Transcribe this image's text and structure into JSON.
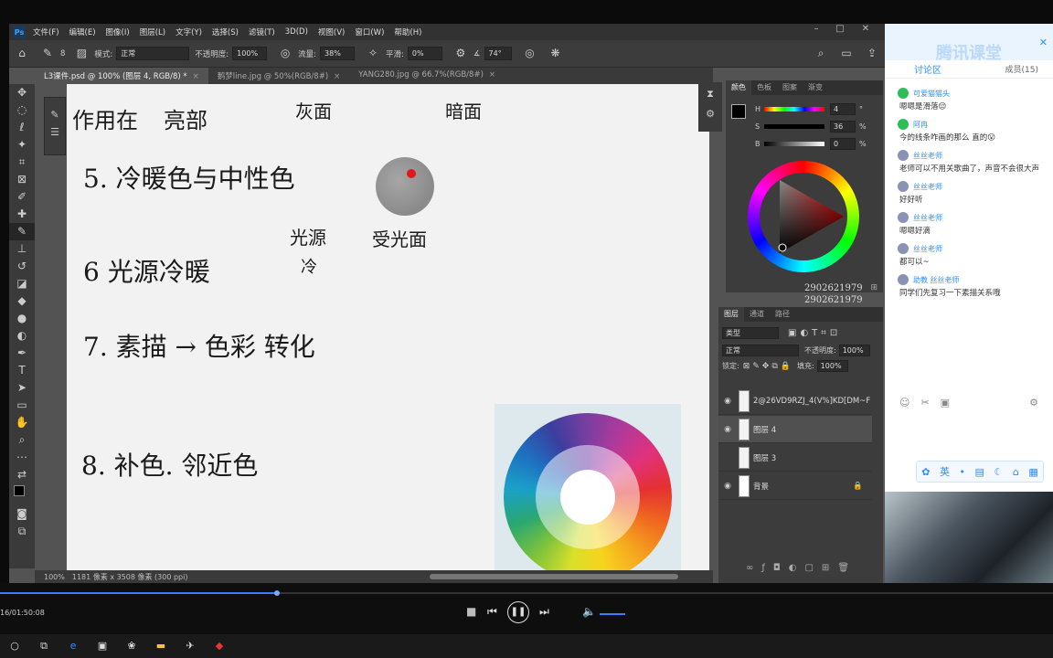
{
  "menu": [
    "文件(F)",
    "编辑(E)",
    "图像(I)",
    "图层(L)",
    "文字(Y)",
    "选择(S)",
    "滤镜(T)",
    "3D(D)",
    "视图(V)",
    "窗口(W)",
    "帮助(H)"
  ],
  "options": {
    "brush_size": "8",
    "mode_label": "模式:",
    "mode_value": "正常",
    "opacity_label": "不透明度:",
    "opacity_value": "100%",
    "flow_label": "流量:",
    "flow_value": "38%",
    "smooth_label": "平滑:",
    "smooth_value": "0%",
    "angle_value": "74°"
  },
  "tabs": [
    {
      "label": "L3课件.psd @ 100% (图层 4, RGB/8) *"
    },
    {
      "label": "鹅梦line.jpg @ 50%(RGB/8#)"
    },
    {
      "label": "YANG280.jpg @ 66.7%(RGB/8#)"
    }
  ],
  "canvas_text": {
    "l1a": "作用在",
    "l1b": "亮部",
    "l1c": "灰面",
    "l1d": "暗面",
    "l5": "5. 冷暖色与中性色",
    "l6": "6  光源冷暖",
    "l6b": "光源",
    "l6c": "冷",
    "l6d": "受光面",
    "l7": "7. 素描 → 色彩 转化",
    "l8": "8. 补色. 邻近色"
  },
  "status": {
    "zoom": "100%",
    "doc_info": "1181 像素 x 3508 像素 (300 ppi)"
  },
  "color_panel": {
    "tabs": [
      "颜色",
      "色板",
      "图案",
      "渐变"
    ],
    "h_label": "H",
    "h_value": "4",
    "h_unit": "°",
    "s_label": "S",
    "s_value": "36",
    "s_unit": "%",
    "b_label": "B",
    "b_value": "0",
    "b_unit": "%",
    "watermark1": "2902621979",
    "watermark2": "2902621979"
  },
  "layers_panel": {
    "tabs": [
      "图层",
      "通道",
      "路径"
    ],
    "filter": "类型",
    "blend": "正常",
    "opacity_label": "不透明度:",
    "opacity_value": "100%",
    "lock_label": "锁定:",
    "fill_label": "填充:",
    "fill_value": "100%",
    "layers": [
      {
        "name": "2@26VD9RZJ_4(V%]KD[DM~F",
        "visible": true
      },
      {
        "name": "图层 4",
        "visible": true
      },
      {
        "name": "图层 3",
        "visible": false
      },
      {
        "name": "背景",
        "visible": true
      }
    ]
  },
  "chat": {
    "brand": "腾讯课堂",
    "tab_discuss": "讨论区",
    "tab_members": "成员(15)",
    "messages": [
      {
        "user": "可爱猫猫头",
        "text": "嗯嗯是滑落😔",
        "teacher": false
      },
      {
        "user": "阿冉",
        "text": "今的线条咋画的那么 直的😮",
        "teacher": false
      },
      {
        "user": "丝丝老师",
        "text": "老师可以不用关歌曲了，声音不会很大声",
        "teacher": true
      },
      {
        "user": "丝丝老师",
        "text": "好好听",
        "teacher": true
      },
      {
        "user": "丝丝老师",
        "text": "嗯嗯好滴",
        "teacher": true
      },
      {
        "user": "丝丝老师",
        "text": "都可以~",
        "teacher": true
      },
      {
        "user": "助教 丝丝老师",
        "text": "同学们先复习一下素描关系哦",
        "teacher": true
      }
    ],
    "ime_label": "英"
  },
  "player": {
    "time": "16/01:50:08"
  }
}
